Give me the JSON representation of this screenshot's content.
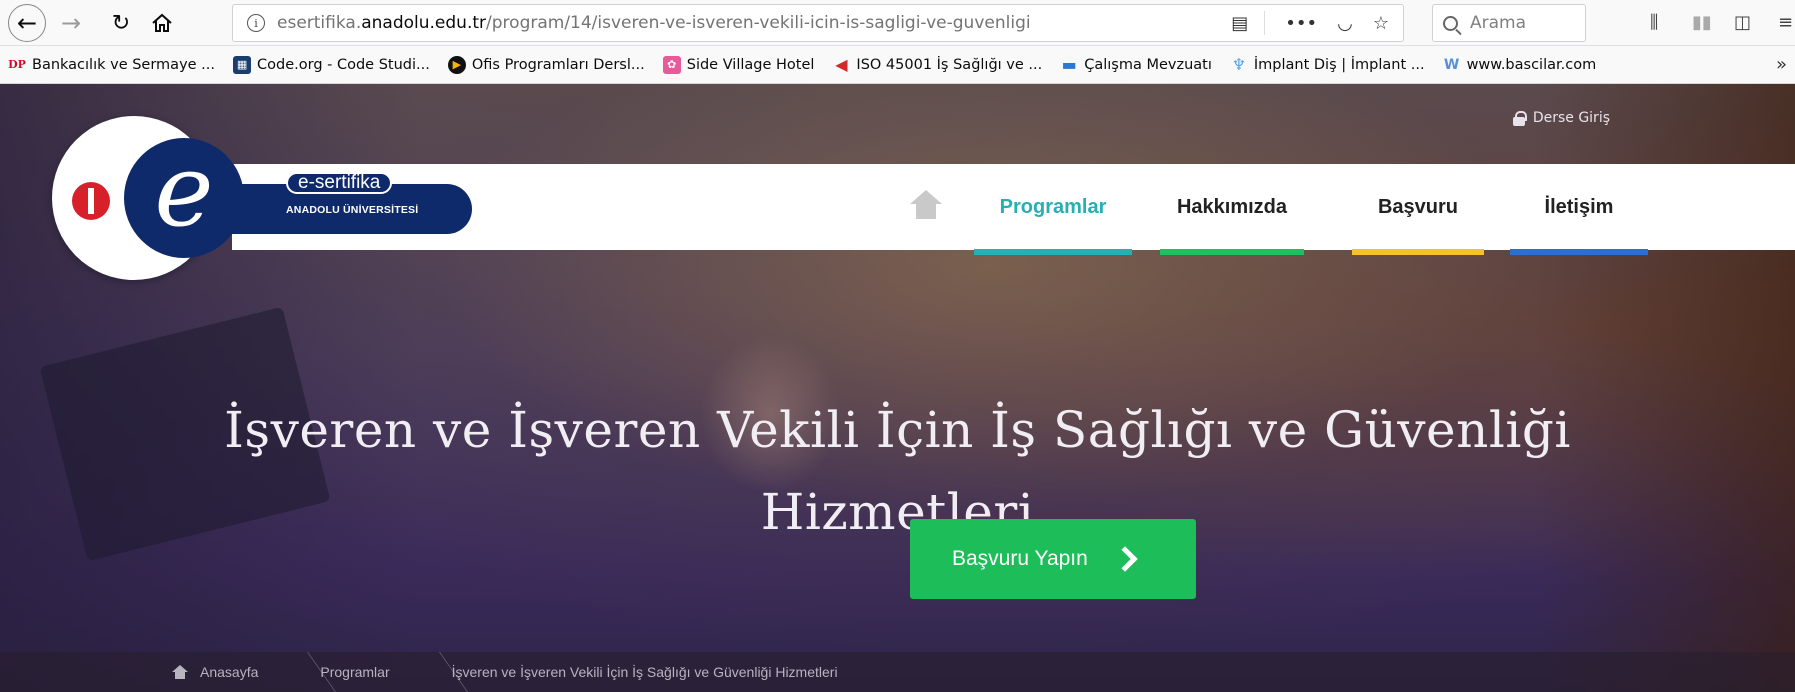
{
  "browser": {
    "url_prefix": "esertifika.",
    "url_host": "anadolu.edu.tr",
    "url_path": "/program/14/isveren-ve-isveren-vekili-icin-is-sagligi-ve-guvenligi",
    "search_placeholder": "Arama"
  },
  "bookmarks": [
    {
      "label": "Bankacılık ve Sermaye ...",
      "icon": "DP",
      "color": "#c8102e"
    },
    {
      "label": "Code.org - Code Studi...",
      "icon": "▦",
      "color": "#1a3c6e"
    },
    {
      "label": "Ofis Programları Dersl...",
      "icon": "▶",
      "color": "#f2b705"
    },
    {
      "label": "Side Village Hotel",
      "icon": "✿",
      "color": "#e85a9a"
    },
    {
      "label": "ISO 45001 İş Sağlığı ve ...",
      "icon": "◀",
      "color": "#d12a2a"
    },
    {
      "label": "Çalışma Mevzuatı",
      "icon": "▬",
      "color": "#2a77d4"
    },
    {
      "label": "İmplant Diş | İmplant ...",
      "icon": "♆",
      "color": "#5aa0e0"
    },
    {
      "label": "www.bascilar.com",
      "icon": "W",
      "color": "#5a8fd4"
    }
  ],
  "site": {
    "login_link": "Derse Giriş",
    "logo_title": "e-sertifika",
    "logo_subtitle": "ANADOLU ÜNİVERSİTESİ",
    "nav": [
      {
        "label": "Programlar",
        "color": "#25b0b4"
      },
      {
        "label": "Hakkımızda",
        "color": "#1ec15f"
      },
      {
        "label": "Başvuru",
        "color": "#f2c42a"
      },
      {
        "label": "İletişim",
        "color": "#2a6fd1"
      }
    ],
    "hero_title_line1": "İşveren ve İşveren Vekili İçin İş Sağlığı ve Güvenliği",
    "hero_title_line2": "Hizmetleri",
    "cta_label": "Başvuru Yapın",
    "breadcrumb": [
      "Anasayfa",
      "Programlar",
      "İşveren ve İşveren Vekili İçin İş Sağlığı ve Güvenliği Hizmetleri"
    ]
  }
}
